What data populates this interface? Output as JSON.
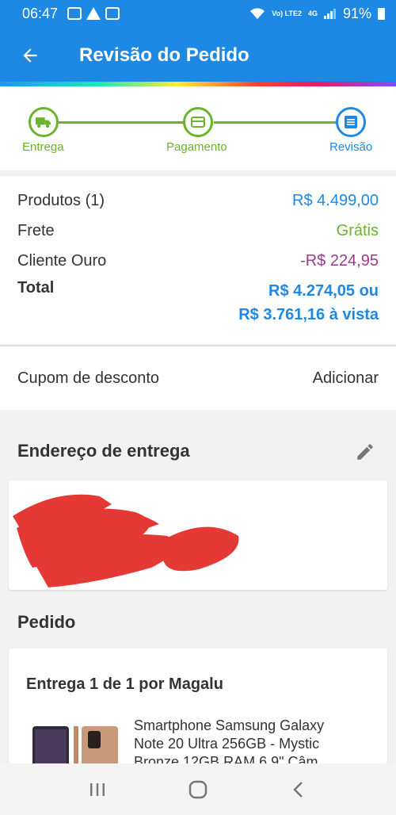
{
  "status": {
    "time": "06:47",
    "network": "Vo) LTE2",
    "net4g": "4G",
    "battery": "91%"
  },
  "app_bar": {
    "title": "Revisão do Pedido"
  },
  "stepper": {
    "steps": [
      {
        "label": "Entrega",
        "state": "done",
        "icon": "truck-icon"
      },
      {
        "label": "Pagamento",
        "state": "done",
        "icon": "card-icon"
      },
      {
        "label": "Revisão",
        "state": "active",
        "icon": "list-icon"
      }
    ]
  },
  "summary": {
    "products_label": "Produtos (1)",
    "products_value": "R$ 4.499,00",
    "shipping_label": "Frete",
    "shipping_value": "Grátis",
    "gold_label": "Cliente Ouro",
    "gold_value": "-R$ 224,95",
    "total_label": "Total",
    "total_value": "R$ 4.274,05 ou",
    "total_cash": "R$ 3.761,16 à vista"
  },
  "coupon": {
    "label": "Cupom de desconto",
    "action": "Adicionar"
  },
  "address": {
    "title": "Endereço de entrega"
  },
  "order": {
    "title": "Pedido",
    "delivery": "Entrega 1 de 1 por Magalu",
    "product_name": "Smartphone Samsung Galaxy Note 20 Ultra 256GB - Mystic Bronze 12GB RAM 6,9\" Câm"
  },
  "colors": {
    "primary": "#1e88e5",
    "success": "#6ab42d",
    "discount": "#9c3a8e",
    "redaction": "#e53935"
  }
}
